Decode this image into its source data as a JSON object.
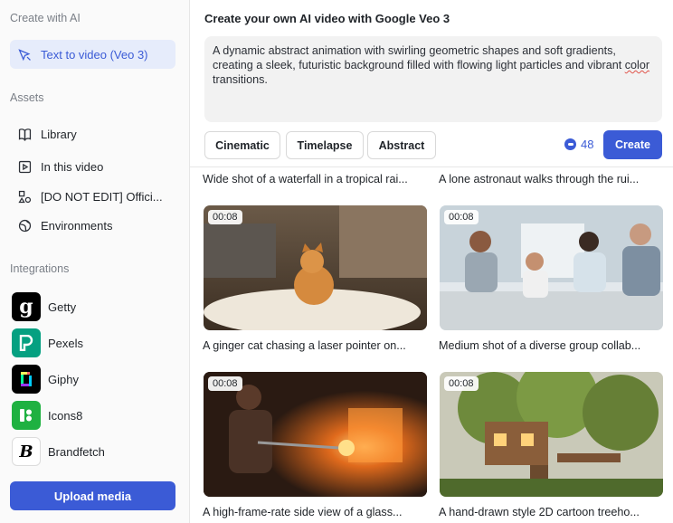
{
  "sidebar": {
    "create_title": "Create with AI",
    "create_item": "Text to video (Veo 3)",
    "assets_title": "Assets",
    "assets": [
      "Library",
      "In this video",
      "[DO NOT EDIT] Offici...",
      "Environments"
    ],
    "integrations_title": "Integrations",
    "integrations": [
      "Getty",
      "Pexels",
      "Giphy",
      "Icons8",
      "Brandfetch"
    ],
    "upload_label": "Upload media"
  },
  "main": {
    "title": "Create your own AI video with Google Veo 3",
    "prompt_a": "A dynamic abstract animation with swirling geometric shapes and soft gradients, creating a sleek, futuristic background filled with flowing light particles and vibrant ",
    "prompt_b": "color",
    "prompt_c": " transitions.",
    "chips": [
      "Cinematic",
      "Timelapse",
      "Abstract"
    ],
    "credits": "48",
    "create_label": "Create"
  },
  "videos": {
    "top_captions": [
      "Wide shot of a waterfall in a tropical rai...",
      "A lone astronaut walks through the rui..."
    ],
    "items": [
      {
        "duration": "00:08",
        "caption": "A ginger cat chasing a laser pointer on..."
      },
      {
        "duration": "00:08",
        "caption": "Medium shot of a diverse group collab..."
      },
      {
        "duration": "00:08",
        "caption": "A high-frame-rate side view of a glass..."
      },
      {
        "duration": "00:08",
        "caption": "A hand-drawn style 2D cartoon treeho..."
      }
    ]
  },
  "colors": {
    "accent": "#3b5bd6",
    "active_bg": "#e6ecfb"
  }
}
